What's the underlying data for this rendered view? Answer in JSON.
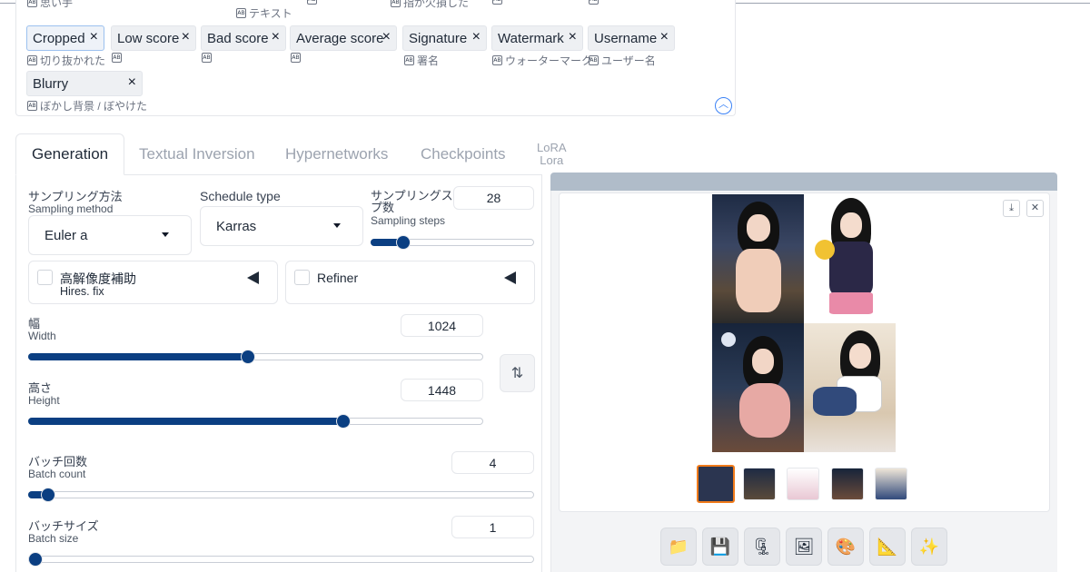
{
  "top_cut_labels": [
    "思い手",
    "テキスト",
    "指が欠損した"
  ],
  "tags": [
    {
      "label": "Cropped",
      "translation": "切り抜かれた",
      "selected": true
    },
    {
      "label": "Low score",
      "translation": ""
    },
    {
      "label": "Bad score",
      "translation": ""
    },
    {
      "label": "Average score",
      "translation": ""
    },
    {
      "label": "Signature",
      "translation": "署名"
    },
    {
      "label": "Watermark",
      "translation": "ウォーターマーク"
    },
    {
      "label": "Username",
      "translation": "ユーザー名"
    },
    {
      "label": "Blurry",
      "translation": "ぼかし背景 / ぼやけた"
    }
  ],
  "tag_remove_glyph": "×",
  "translate_icon": "AB",
  "tabs": [
    "Generation",
    "Textual Inversion",
    "Hypernetworks",
    "Checkpoints"
  ],
  "tab_lora": {
    "line1": "LoRA",
    "line2": "Lora"
  },
  "sampling_method": {
    "label_jp": "サンプリング方法",
    "label_en": "Sampling method",
    "value": "Euler a"
  },
  "schedule_type": {
    "label": "Schedule type",
    "value": "Karras"
  },
  "sampling_steps": {
    "label_jp1": "サンプリングステッ",
    "label_jp2": "プ数",
    "label_en": "Sampling steps",
    "value": "28",
    "fraction": 0.2
  },
  "hires": {
    "label_jp": "高解像度補助",
    "label_en": "Hires. fix"
  },
  "refiner": {
    "label": "Refiner"
  },
  "width": {
    "label_jp": "幅",
    "label_en": "Width",
    "value": "1024",
    "fraction": 0.484
  },
  "height": {
    "label_jp": "高さ",
    "label_en": "Height",
    "value": "1448",
    "fraction": 0.692
  },
  "batch_count": {
    "label_jp": "バッチ回数",
    "label_en": "Batch count",
    "value": "4",
    "fraction": 0.04
  },
  "batch_size": {
    "label_jp": "バッチサイズ",
    "label_en": "Batch size",
    "value": "1",
    "fraction": 0.0
  },
  "swap_icon": "⇅",
  "gallery_buttons": {
    "download": "⤓",
    "close": "✕"
  },
  "toolbar_icons": [
    {
      "name": "folder-icon",
      "glyph": "📁"
    },
    {
      "name": "save-icon",
      "glyph": "💾"
    },
    {
      "name": "zip-icon",
      "glyph": "🗜"
    },
    {
      "name": "image-icon",
      "glyph": "🖼"
    },
    {
      "name": "palette-icon",
      "glyph": "🎨"
    },
    {
      "name": "ruler-icon",
      "glyph": "📐"
    },
    {
      "name": "sparkle-icon",
      "glyph": "✨"
    }
  ],
  "colors": {
    "accent": "#0b3f82",
    "selected_thumb": "#f07b1b",
    "progress": "#b0bcc9"
  }
}
